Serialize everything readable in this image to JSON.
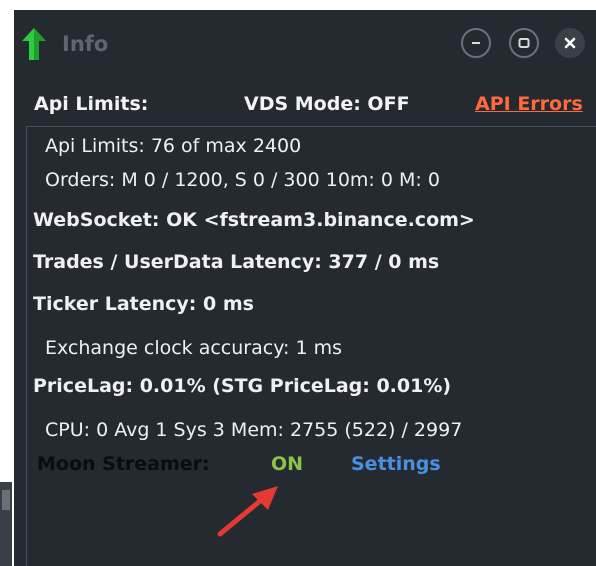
{
  "window": {
    "title": "Info",
    "controls": {
      "minimize_icon": "minimize-icon",
      "maximize_icon": "maximize-icon",
      "close_icon": "close-icon"
    }
  },
  "header": {
    "api_limits_label": "Api Limits:",
    "vds_mode": "VDS Mode: OFF",
    "api_errors_link": "API Errors"
  },
  "info": {
    "api_limits": "Api Limits: 76 of max 2400",
    "orders": "Orders: M 0 / 1200, S 0 / 300  10m: 0 M: 0",
    "websocket": "WebSocket: OK <fstream3.binance.com>",
    "trades_latency": "Trades / UserData Latency: 377 / 0 ms",
    "ticker_latency": "Ticker Latency: 0 ms",
    "clock_accuracy": "Exchange clock accuracy: 1 ms",
    "price_lag": "PriceLag: 0.01% (STG PriceLag: 0.01%)",
    "cpu_mem": "CPU: 0 Avg 1 Sys 3 Mem: 2755 (522) / 2997"
  },
  "moon_streamer": {
    "label": "Moon Streamer:",
    "status": "ON",
    "settings_link": "Settings"
  },
  "colors": {
    "window_bg": "#252a30",
    "api_errors": "#ff6a3d",
    "on_status": "#8bc34a",
    "settings_link": "#4a90e2",
    "arrow_annotation": "#e53935",
    "title_arrow": "#2ecc40"
  }
}
